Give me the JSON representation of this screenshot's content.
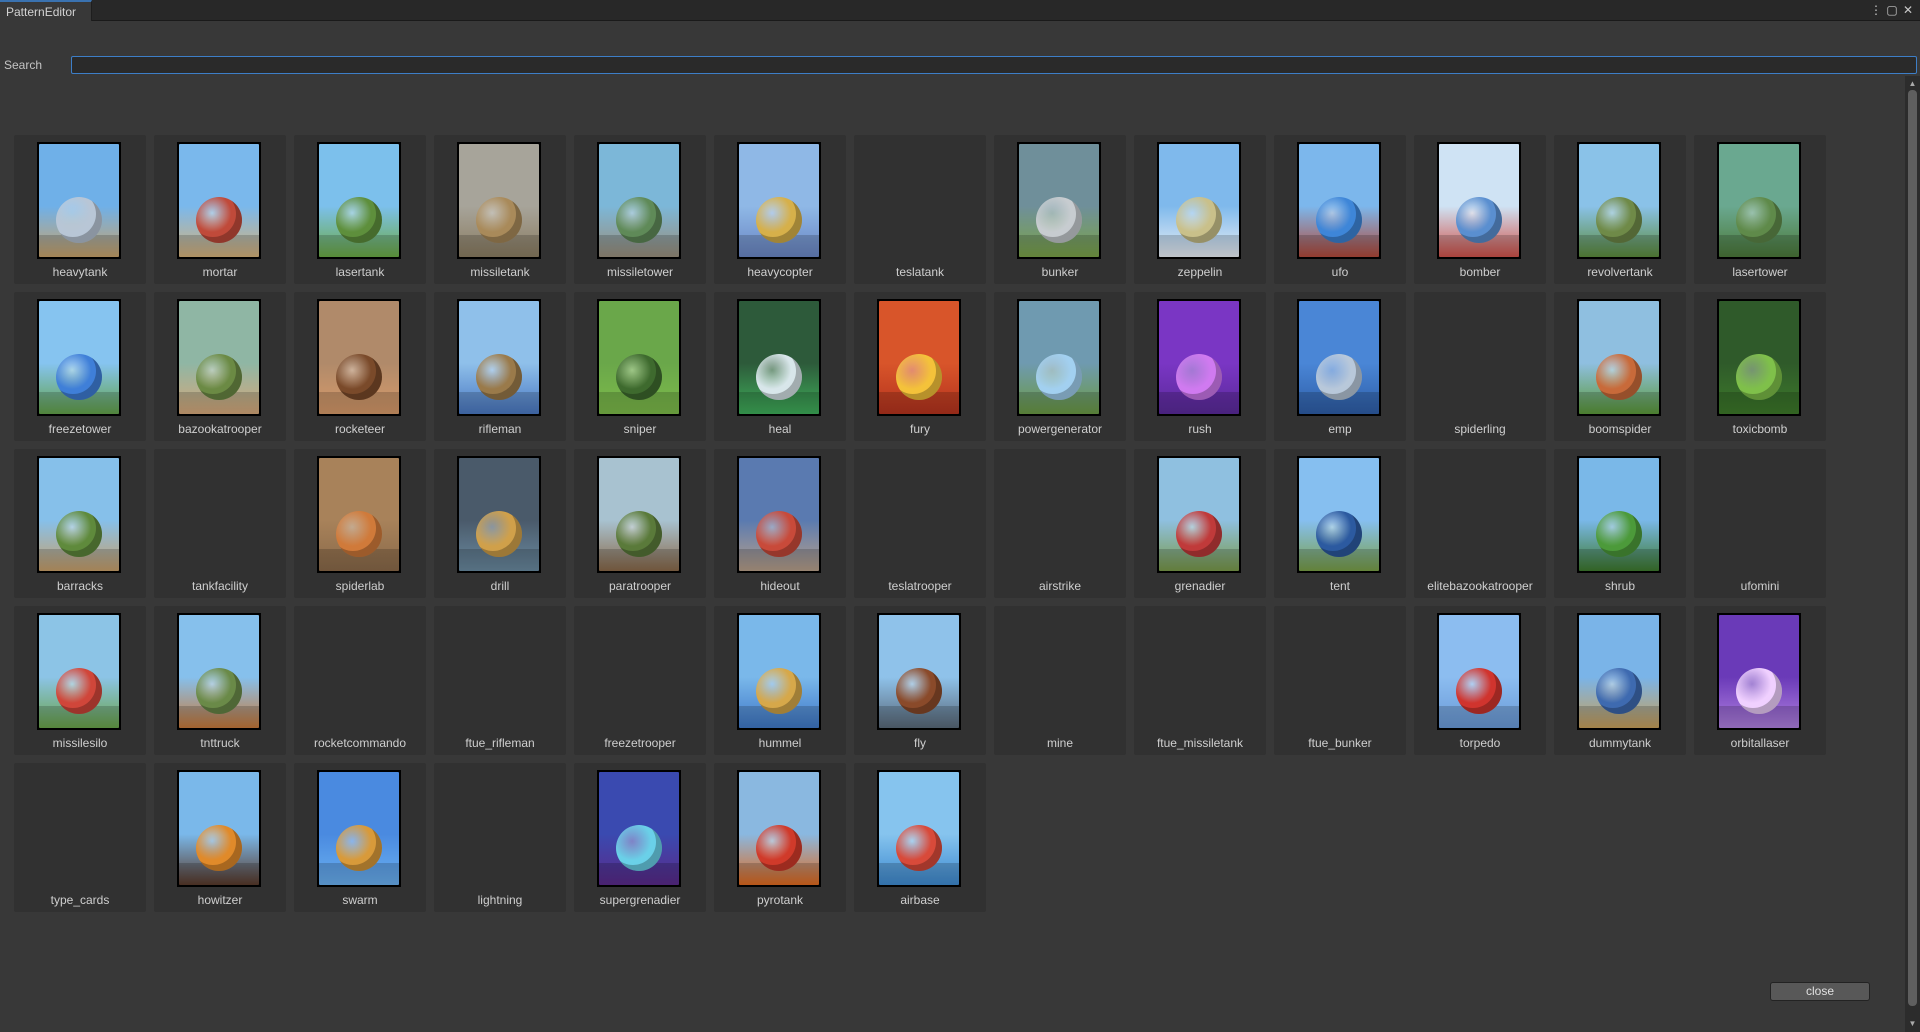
{
  "window": {
    "tab_title": "PatternEditor",
    "controls": [
      {
        "name": "more-options-icon",
        "glyph": "⋮"
      },
      {
        "name": "maximize-icon",
        "glyph": "▢"
      },
      {
        "name": "close-window-icon",
        "glyph": "✕"
      }
    ]
  },
  "search": {
    "label": "Search",
    "value": ""
  },
  "close_button": "close",
  "cards": [
    {
      "label": "heavytank",
      "has_image": true,
      "sky": "#6fb0e8",
      "accent": "#b8c6d6",
      "ground": "#c9a36a"
    },
    {
      "label": "mortar",
      "has_image": true,
      "sky": "#7ab8ec",
      "accent": "#c04a3a",
      "ground": "#d6b27a"
    },
    {
      "label": "lasertank",
      "has_image": true,
      "sky": "#7cc0ec",
      "accent": "#5e8f3c",
      "ground": "#6cab45"
    },
    {
      "label": "missiletank",
      "has_image": true,
      "sky": "#a7a49a",
      "accent": "#a98a5a",
      "ground": "#8b7d62"
    },
    {
      "label": "missiletower",
      "has_image": true,
      "sky": "#7cb7d8",
      "accent": "#5f8a58",
      "ground": "#9a8f7c"
    },
    {
      "label": "heavycopter",
      "has_image": true,
      "sky": "#8fb8e6",
      "accent": "#d6b04a",
      "ground": "#6a86c4"
    },
    {
      "label": "teslatank",
      "has_image": false
    },
    {
      "label": "bunker",
      "has_image": true,
      "sky": "#6f8f9a",
      "accent": "#c7ccd0",
      "ground": "#7aa348"
    },
    {
      "label": "zeppelin",
      "has_image": true,
      "sky": "#7fb9ec",
      "accent": "#c9c08a",
      "ground": "#e9eef4"
    },
    {
      "label": "ufo",
      "has_image": true,
      "sky": "#7cb7ec",
      "accent": "#3e86d8",
      "ground": "#b34a3a"
    },
    {
      "label": "bomber",
      "has_image": true,
      "sky": "#cfe3f4",
      "accent": "#5a8fd0",
      "ground": "#d0524a"
    },
    {
      "label": "revolvertank",
      "has_image": true,
      "sky": "#8ac2e8",
      "accent": "#6f8a48",
      "ground": "#5c8c3c"
    },
    {
      "label": "lasertower",
      "has_image": true,
      "sky": "#6aa890",
      "accent": "#5f8a4a",
      "ground": "#4c7a3a"
    },
    {
      "label": "freezetower",
      "has_image": true,
      "sky": "#86c4f0",
      "accent": "#3f7fd8",
      "ground": "#63a24a"
    },
    {
      "label": "bazookatrooper",
      "has_image": true,
      "sky": "#8fb6a4",
      "accent": "#6b8a44",
      "ground": "#d6a87a"
    },
    {
      "label": "rocketeer",
      "has_image": true,
      "sky": "#b08a6a",
      "accent": "#7a4a2a",
      "ground": "#d79a6a"
    },
    {
      "label": "rifleman",
      "has_image": true,
      "sky": "#8fc0ea",
      "accent": "#9a7a4a",
      "ground": "#4a78c2"
    },
    {
      "label": "sniper",
      "has_image": true,
      "sky": "#6aa74a",
      "accent": "#3e6a2e",
      "ground": "#7dbb4a"
    },
    {
      "label": "heal",
      "has_image": true,
      "sky": "#2d5a3a",
      "accent": "#d8e6ea",
      "ground": "#3fae5a"
    },
    {
      "label": "fury",
      "has_image": true,
      "sky": "#d8552a",
      "accent": "#f4c23a",
      "ground": "#b5331e"
    },
    {
      "label": "powergenerator",
      "has_image": true,
      "sky": "#6f9ab0",
      "accent": "#a2d0f0",
      "ground": "#6b9a44"
    },
    {
      "label": "rush",
      "has_image": true,
      "sky": "#7a36c4",
      "accent": "#d07af0",
      "ground": "#5a2a9a"
    },
    {
      "label": "emp",
      "has_image": true,
      "sky": "#4a86d6",
      "accent": "#b8c8da",
      "ground": "#2e5ea8"
    },
    {
      "label": "spiderling",
      "has_image": false
    },
    {
      "label": "boomspider",
      "has_image": true,
      "sky": "#8fbfe0",
      "accent": "#c86a3a",
      "ground": "#5c9a3a"
    },
    {
      "label": "toxicbomb",
      "has_image": true,
      "sky": "#2f5a2a",
      "accent": "#7fc04a",
      "ground": "#3d7a2a"
    },
    {
      "label": "barracks",
      "has_image": true,
      "sky": "#86c0ea",
      "accent": "#5f8a3c",
      "ground": "#c8a06a"
    },
    {
      "label": "tankfacility",
      "has_image": false
    },
    {
      "label": "spiderlab",
      "has_image": true,
      "sky": "#a8825a",
      "accent": "#d07a3a",
      "ground": "#8a6a4a"
    },
    {
      "label": "drill",
      "has_image": true,
      "sky": "#4a5a6a",
      "accent": "#d0a04a",
      "ground": "#6a8aa0"
    },
    {
      "label": "paratrooper",
      "has_image": true,
      "sky": "#a8c2d0",
      "accent": "#5a7a3a",
      "ground": "#8a6a4a"
    },
    {
      "label": "hideout",
      "has_image": true,
      "sky": "#5a7ab0",
      "accent": "#c84a3a",
      "ground": "#b8a08a"
    },
    {
      "label": "teslatrooper",
      "has_image": false
    },
    {
      "label": "airstrike",
      "has_image": false
    },
    {
      "label": "grenadier",
      "has_image": true,
      "sky": "#8fc0e0",
      "accent": "#c03a3a",
      "ground": "#7a9a4a"
    },
    {
      "label": "tent",
      "has_image": true,
      "sky": "#86bff0",
      "accent": "#2c5aa0",
      "ground": "#7aa048"
    },
    {
      "label": "elitebazookatrooper",
      "has_image": false
    },
    {
      "label": "shrub",
      "has_image": true,
      "sky": "#7ab8e8",
      "accent": "#4c9a3a",
      "ground": "#3e7a2e"
    },
    {
      "label": "ufomini",
      "has_image": false
    },
    {
      "label": "missilesilo",
      "has_image": true,
      "sky": "#8cc4e6",
      "accent": "#d0463a",
      "ground": "#6aa44a"
    },
    {
      "label": "tnttruck",
      "has_image": true,
      "sky": "#86c0ec",
      "accent": "#6a8a48",
      "ground": "#c87a3a"
    },
    {
      "label": "rocketcommando",
      "has_image": false
    },
    {
      "label": "ftue_rifleman",
      "has_image": false
    },
    {
      "label": "freezetrooper",
      "has_image": false
    },
    {
      "label": "hummel",
      "has_image": true,
      "sky": "#7ab8ea",
      "accent": "#d6a84a",
      "ground": "#3f78c8"
    },
    {
      "label": "fly",
      "has_image": true,
      "sky": "#8fc2ea",
      "accent": "#8a4a2a",
      "ground": "#5a6a7a"
    },
    {
      "label": "mine",
      "has_image": false
    },
    {
      "label": "ftue_missiletank",
      "has_image": false
    },
    {
      "label": "ftue_bunker",
      "has_image": false
    },
    {
      "label": "torpedo",
      "has_image": true,
      "sky": "#8cbdf0",
      "accent": "#d0342e",
      "ground": "#6a9ad8"
    },
    {
      "label": "dummytank",
      "has_image": true,
      "sky": "#7ab4e8",
      "accent": "#3e6ab0",
      "ground": "#c8a05a"
    },
    {
      "label": "orbitallaser",
      "has_image": true,
      "sky": "#6a3ab8",
      "accent": "#f0d0ff",
      "ground": "#b080e0"
    },
    {
      "label": "type_cards",
      "has_image": false
    },
    {
      "label": "howitzer",
      "has_image": true,
      "sky": "#7ab8ea",
      "accent": "#e08a2a",
      "ground": "#5a3a2a"
    },
    {
      "label": "swarm",
      "has_image": true,
      "sky": "#4a8ae0",
      "accent": "#d89a3a",
      "ground": "#6ab0f0"
    },
    {
      "label": "lightning",
      "has_image": false
    },
    {
      "label": "supergrenadier",
      "has_image": true,
      "sky": "#3a4ab0",
      "accent": "#6ad0e8",
      "ground": "#5a2a8a"
    },
    {
      "label": "pyrotank",
      "has_image": true,
      "sky": "#8ab8e0",
      "accent": "#d03a2a",
      "ground": "#e06a1e"
    },
    {
      "label": "airbase",
      "has_image": true,
      "sky": "#86c4ee",
      "accent": "#d84a3a",
      "ground": "#3e8ad0"
    }
  ]
}
